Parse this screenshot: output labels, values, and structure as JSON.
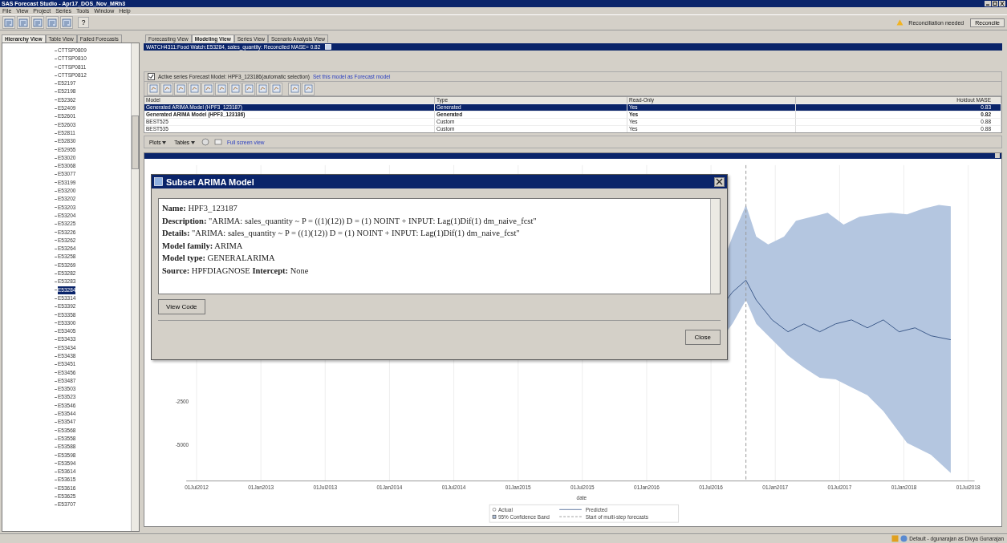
{
  "window": {
    "title": "SAS Forecast Studio - Apr17_DOS_Nov_MRh3"
  },
  "menu": [
    "File",
    "View",
    "Project",
    "Series",
    "Tools",
    "Window",
    "Help"
  ],
  "help_button": "?",
  "reconcile": {
    "message": "Reconciliation needed",
    "button": "Reconcile"
  },
  "left_tabs": [
    {
      "label": "Hierarchy View",
      "selected": true
    },
    {
      "label": "Table View",
      "selected": false
    },
    {
      "label": "Failed Forecasts",
      "selected": false
    }
  ],
  "tree_items": [
    {
      "label": "CTTSP0809",
      "selected": false
    },
    {
      "label": "CTTSP0810",
      "selected": false
    },
    {
      "label": "CTTSP0811",
      "selected": false
    },
    {
      "label": "CTTSP0812",
      "selected": false
    },
    {
      "label": "E52197",
      "selected": false
    },
    {
      "label": "E52198",
      "selected": false
    },
    {
      "label": "E52362",
      "selected": false
    },
    {
      "label": "E52409",
      "selected": false
    },
    {
      "label": "E52601",
      "selected": false
    },
    {
      "label": "E52603",
      "selected": false
    },
    {
      "label": "E52811",
      "selected": false
    },
    {
      "label": "E52830",
      "selected": false
    },
    {
      "label": "E52955",
      "selected": false
    },
    {
      "label": "E53020",
      "selected": false
    },
    {
      "label": "E53068",
      "selected": false
    },
    {
      "label": "E53077",
      "selected": false
    },
    {
      "label": "E53199",
      "selected": false
    },
    {
      "label": "E53200",
      "selected": false
    },
    {
      "label": "E53202",
      "selected": false
    },
    {
      "label": "E53203",
      "selected": false
    },
    {
      "label": "E53204",
      "selected": false
    },
    {
      "label": "E53225",
      "selected": false
    },
    {
      "label": "E53226",
      "selected": false
    },
    {
      "label": "E53262",
      "selected": false
    },
    {
      "label": "E53264",
      "selected": false
    },
    {
      "label": "E53258",
      "selected": false
    },
    {
      "label": "E53269",
      "selected": false
    },
    {
      "label": "E53282",
      "selected": false
    },
    {
      "label": "E53283",
      "selected": false
    },
    {
      "label": "E53284",
      "selected": true
    },
    {
      "label": "E53314",
      "selected": false
    },
    {
      "label": "E53392",
      "selected": false
    },
    {
      "label": "E53358",
      "selected": false
    },
    {
      "label": "E53300",
      "selected": false
    },
    {
      "label": "E53405",
      "selected": false
    },
    {
      "label": "E53433",
      "selected": false
    },
    {
      "label": "E53434",
      "selected": false
    },
    {
      "label": "E53438",
      "selected": false
    },
    {
      "label": "E53451",
      "selected": false
    },
    {
      "label": "E53456",
      "selected": false
    },
    {
      "label": "E53487",
      "selected": false
    },
    {
      "label": "E53503",
      "selected": false
    },
    {
      "label": "E53523",
      "selected": false
    },
    {
      "label": "E53546",
      "selected": false
    },
    {
      "label": "E53544",
      "selected": false
    },
    {
      "label": "E53547",
      "selected": false
    },
    {
      "label": "E53568",
      "selected": false
    },
    {
      "label": "E53558",
      "selected": false
    },
    {
      "label": "E53588",
      "selected": false
    },
    {
      "label": "E53598",
      "selected": false
    },
    {
      "label": "E53594",
      "selected": false
    },
    {
      "label": "E53614",
      "selected": false
    },
    {
      "label": "E53615",
      "selected": false
    },
    {
      "label": "E53616",
      "selected": false
    },
    {
      "label": "E53625",
      "selected": false
    },
    {
      "label": "E53707",
      "selected": false
    }
  ],
  "view_tabs": [
    {
      "label": "Forecasting View",
      "selected": false
    },
    {
      "label": "Modeling View",
      "selected": true
    },
    {
      "label": "Series View",
      "selected": false
    },
    {
      "label": "Scenario Analysis View",
      "selected": false
    }
  ],
  "series_bar": {
    "text": "WATCH4311:Food Watch:E53284, sales_quantity: Reconciled MASE= 0.82"
  },
  "active_series": {
    "checked": true,
    "text": "Active series  Forecast Model: HPF3_123186(automatic selection)",
    "link": "Set this model as Forecast model"
  },
  "model_table": {
    "columns": [
      "Model",
      "Type",
      "Read-Only",
      "Holdout MASE"
    ],
    "rows": [
      {
        "cells": [
          "Generated ARIMA Model (HPF3_123187)",
          "Generated",
          "Yes",
          "0.83"
        ],
        "selected": true,
        "bold": false
      },
      {
        "cells": [
          "Generated ARIMA Model (HPF3_123186)",
          "Generated",
          "Yes",
          "0.82"
        ],
        "selected": false,
        "bold": true
      },
      {
        "cells": [
          "BEST525",
          "Custom",
          "Yes",
          "0.88"
        ],
        "selected": false,
        "bold": false
      },
      {
        "cells": [
          "BEST535",
          "Custom",
          "Yes",
          "0.88"
        ],
        "selected": false,
        "bold": false
      }
    ]
  },
  "plot_toolbar": {
    "plots": "Plots",
    "tables": "Tables",
    "full_screen": "Full screen view"
  },
  "chart": {
    "y_tick_labels": [
      "-2500",
      "-5000"
    ],
    "x_tick_labels": [
      "01Jul2012",
      "01Jan2013",
      "01Jul2013",
      "01Jan2014",
      "01Jul2014",
      "01Jan2015",
      "01Jul2015",
      "01Jan2016",
      "01Jul2016",
      "01Jan2017",
      "01Jul2017",
      "01Jan2018",
      "01Jul2018"
    ],
    "x_axis_label": "date",
    "legend": [
      {
        "kind": "marker",
        "label": "Actual"
      },
      {
        "kind": "line",
        "label": "Predicted"
      },
      {
        "kind": "band",
        "label": "95% Confidence Band"
      },
      {
        "kind": "dashed",
        "label": "Start of multi-step forecasts"
      }
    ]
  },
  "dialog": {
    "title": "Subset ARIMA Model",
    "lines": [
      "**Name:** HPF3_123187",
      "**Description:** \"ARIMA: sales_quantity ~ P = ((1)(12)) D = (1) NOINT + INPUT: Lag(1)Dif(1) dm_naive_fcst\"",
      "**Details:** \"ARIMA: sales_quantity ~ P = ((1)(12)) D = (1) NOINT + INPUT: Lag(1)Dif(1) dm_naive_fcst\"",
      "**Model family:** ARIMA",
      "**Model type:** GENERALARIMA",
      "**Source:** HPFDIAGNOSE **Intercept:** None"
    ],
    "view_code": "View Code",
    "close": "Close"
  },
  "status_bar": {
    "text": "Default - dgunarajan as Divya Gunarajan"
  }
}
